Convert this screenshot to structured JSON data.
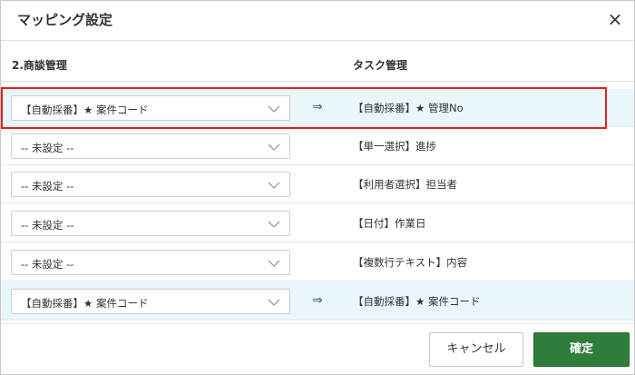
{
  "dialog": {
    "title": "マッピング設定",
    "close_glyph": "×"
  },
  "columns": {
    "left": "2.商談管理",
    "right": "タスク管理"
  },
  "arrow_glyph": "⇒",
  "rows": [
    {
      "select_value": "【自動採番】★ 案件コード",
      "arrow": "⇒",
      "target": "【自動採番】★ 管理No",
      "highlighted": true
    },
    {
      "select_value": "-- 未設定 --",
      "arrow": "",
      "target": "【単一選択】進捗",
      "highlighted": false
    },
    {
      "select_value": "-- 未設定 --",
      "arrow": "",
      "target": "【利用者選択】担当者",
      "highlighted": false
    },
    {
      "select_value": "-- 未設定 --",
      "arrow": "",
      "target": "【日付】作業日",
      "highlighted": false
    },
    {
      "select_value": "-- 未設定 --",
      "arrow": "",
      "target": "【複数行テキスト】内容",
      "highlighted": false
    },
    {
      "select_value": "【自動採番】★ 案件コード",
      "arrow": "⇒",
      "target": "【自動採番】★ 案件コード",
      "highlighted": true
    }
  ],
  "footer": {
    "cancel_label": "キャンセル",
    "confirm_label": "確定"
  },
  "colors": {
    "highlight_row": "#e9f6fc",
    "annotation_box": "#e02020",
    "confirm_button": "#2e7d3a"
  }
}
